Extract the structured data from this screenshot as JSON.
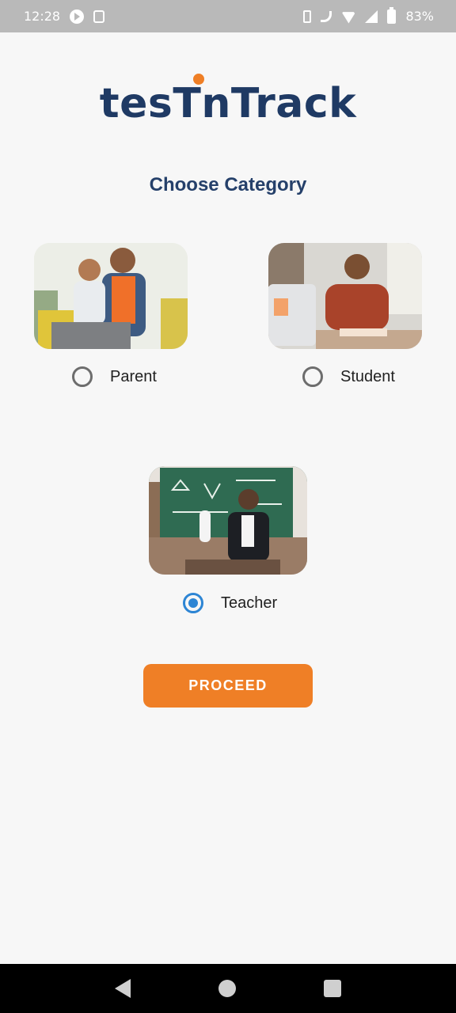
{
  "status_bar": {
    "time": "12:28",
    "battery": "83%",
    "icons": [
      "play-icon",
      "data-icon",
      "vibrate-icon",
      "wifi-call-icon",
      "wifi-icon",
      "signal-icon",
      "battery-icon"
    ]
  },
  "logo": {
    "text": "tesTnTrack",
    "accent_color": "#ef7f26",
    "text_color": "#1f3a64"
  },
  "title": "Choose Category",
  "categories": [
    {
      "label": "Parent",
      "selected": false
    },
    {
      "label": "Student",
      "selected": false
    },
    {
      "label": "Teacher",
      "selected": true
    }
  ],
  "proceed_label": "PROCEED",
  "colors": {
    "accent": "#ef7f26",
    "radio_selected": "#2d85d4",
    "title": "#25406a"
  },
  "nav_bar": {
    "icons": [
      "back-icon",
      "home-icon",
      "recent-apps-icon"
    ]
  }
}
